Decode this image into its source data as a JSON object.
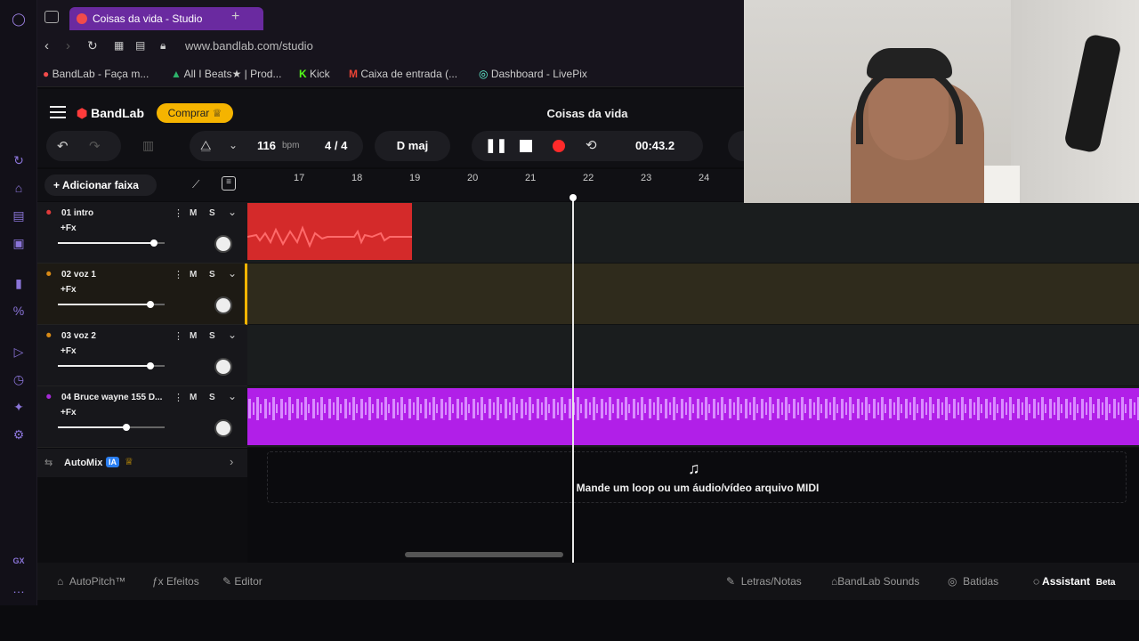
{
  "browser": {
    "tab_title": "Coisas da vida - Studio",
    "url": "www.bandlab.com/studio",
    "bookmarks": [
      "BandLab - Faça m...",
      "All I Beats★ | Prod...",
      "Kick",
      "Caixa de entrada (...",
      "Dashboard - LivePix"
    ],
    "new_tab": "+"
  },
  "app": {
    "logo": "BandLab",
    "buy_label": "Comprar",
    "project_title": "Coisas da vida",
    "tempo": "116",
    "tempo_unit": "bpm",
    "time_sig": "4 / 4",
    "key": "D maj",
    "time": "00:43.2",
    "add_track": "Adicionar faixa"
  },
  "ruler": [
    "17",
    "18",
    "19",
    "20",
    "21",
    "22",
    "23",
    "24"
  ],
  "tracks": [
    {
      "name": "01  intro",
      "fx": "+Fx",
      "volume": 0.9,
      "color": "#e03a3a"
    },
    {
      "name": "02  voz 1",
      "fx": "+Fx",
      "volume": 0.87,
      "color": "#d88a16"
    },
    {
      "name": "03  voz 2",
      "fx": "+Fx",
      "volume": 0.87,
      "color": "#d88a16"
    },
    {
      "name": "04  Bruce wayne 155 D...",
      "fx": "+Fx",
      "volume": 0.64,
      "color": "#a52ad6"
    }
  ],
  "mute_label": "M",
  "solo_label": "S",
  "automix": {
    "label": "AutoMix",
    "badge": "IA"
  },
  "drop_hint": "Mande um loop ou um áudio/vídeo arquivo MIDI",
  "bottom": {
    "autopitch": "AutoPitch™",
    "effects": "Efeitos",
    "editor": "Editor",
    "lyrics": "Letras/Notas",
    "sounds": "BandLab Sounds",
    "beats": "Batidas",
    "assistant": "Assistant",
    "assistant_badge": "Beta"
  },
  "sidebar_bottom": "GX",
  "colors": {
    "accent": "#ff3b3b",
    "purple": "#a52ad6",
    "gold": "#f5b400"
  }
}
